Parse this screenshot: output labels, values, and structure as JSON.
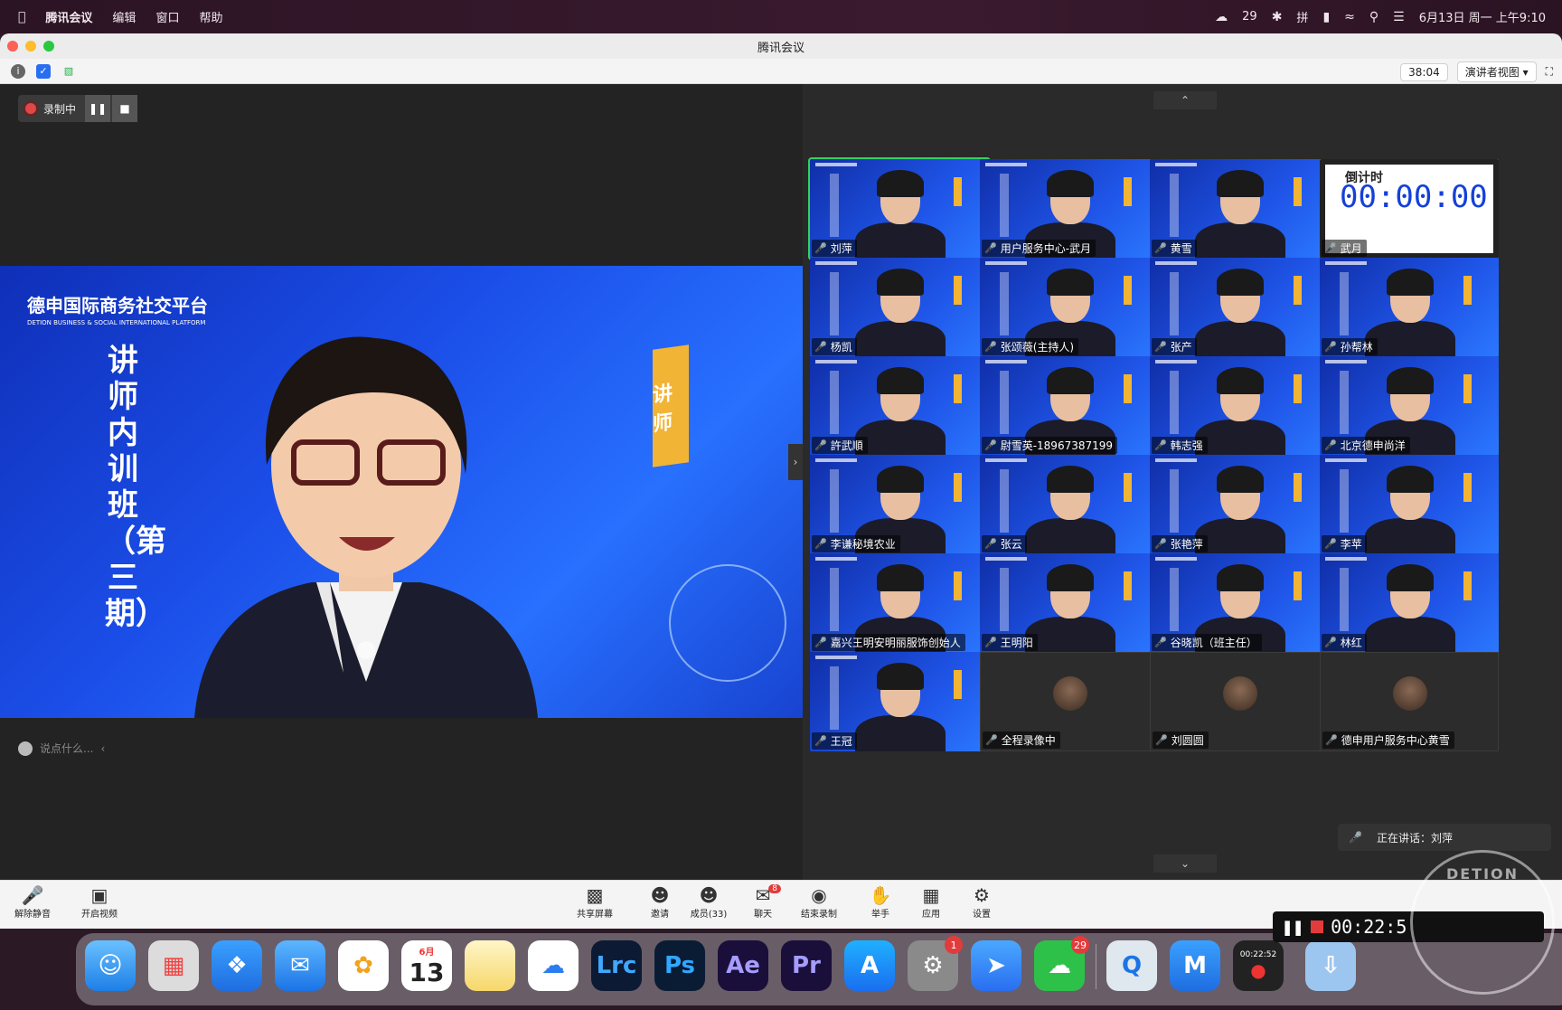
{
  "menubar": {
    "app": "腾讯会议",
    "items": [
      "编辑",
      "窗口",
      "帮助"
    ],
    "wechat_count": "29",
    "input_method": "拼",
    "datetime": "6月13日 周一 上午9:10"
  },
  "window": {
    "title": "腾讯会议",
    "duration": "38:04",
    "view_mode": "演讲者视图"
  },
  "recording": {
    "label": "录制中"
  },
  "stage": {
    "platform_name": "德申国际商务社交平台",
    "platform_sub": "DETION BUSINESS & SOCIAL INTERNATIONAL PLATFORM",
    "banner_vertical": "讲师内训班（第三期）",
    "badge": "讲师"
  },
  "chat": {
    "placeholder": "说点什么..."
  },
  "timer_tile": {
    "heading": "倒计时",
    "value": "00:00:00"
  },
  "participants": [
    {
      "name": "刘萍",
      "active": true
    },
    {
      "name": "用户服务中心-武月"
    },
    {
      "name": "黄雪"
    },
    {
      "name": "武月",
      "timer": true
    },
    {
      "name": "杨凯"
    },
    {
      "name": "张颂薇(主持人)"
    },
    {
      "name": "张产"
    },
    {
      "name": "孙帮林"
    },
    {
      "name": "許武順"
    },
    {
      "name": "尉雪英-18967387199"
    },
    {
      "name": "韩志强"
    },
    {
      "name": "北京德申尚洋"
    },
    {
      "name": "李谦秘境农业"
    },
    {
      "name": "张云"
    },
    {
      "name": "张艳萍"
    },
    {
      "name": "李苹"
    },
    {
      "name": "嘉兴王明安明丽服饰创始人"
    },
    {
      "name": "王明阳"
    },
    {
      "name": "谷晓凯（班主任）"
    },
    {
      "name": "林红"
    },
    {
      "name": "王冠"
    },
    {
      "name": "全程录像中",
      "dark": true
    },
    {
      "name": "刘圆圆",
      "dark": true
    },
    {
      "name": "德申用户服务中心黄雪",
      "dark": true
    }
  ],
  "speaking": {
    "label": "正在讲话：",
    "name": "刘萍"
  },
  "controls": {
    "unmute": "解除静音",
    "video": "开启视频",
    "share": "共享屏幕",
    "invite": "邀请",
    "members": "成员(33)",
    "chat": "聊天",
    "chat_badge": "8",
    "end_record": "结束录制",
    "raise_hand": "举手",
    "apps": "应用",
    "settings": "设置"
  },
  "dock": {
    "calendar_month": "6月",
    "calendar_day": "13",
    "settings_badge": "1",
    "wechat_badge": "29",
    "rec_time_small": "00:22:52"
  },
  "rec_widget": {
    "time": "00:22:5"
  },
  "watermark": "DETION"
}
